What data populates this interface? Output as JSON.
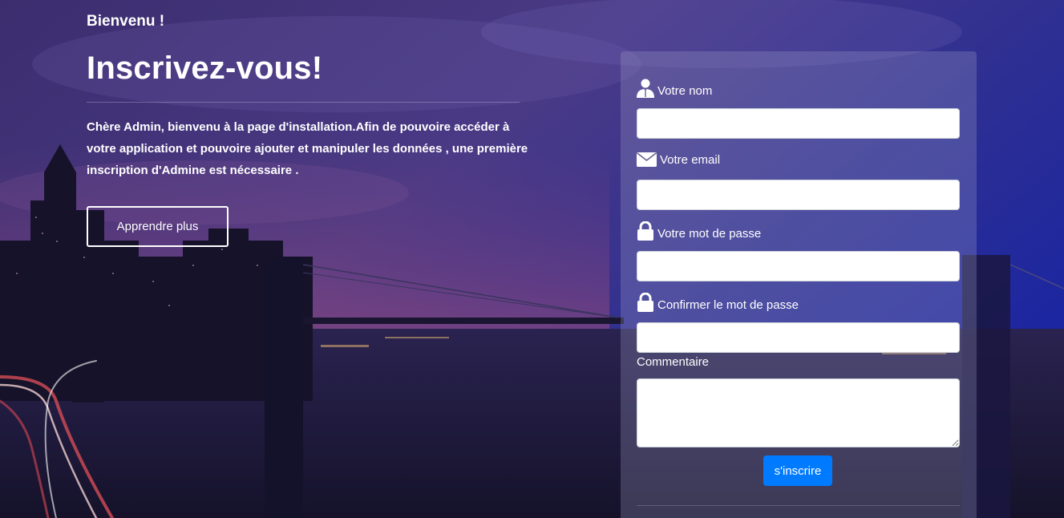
{
  "page": {
    "welcome": "Bienvenu !",
    "headline": "Inscrivez-vous!",
    "intro": "Chère Admin, bienvenu à la page d'installation.Afin de pouvoire accéder à votre application et pouvoire ajouter et manipuler les données , une première inscription d'Admine est nécessaire .",
    "learn_more_label": "Apprendre plus"
  },
  "form": {
    "name_label": "Votre nom",
    "name_icon": "user-icon",
    "email_label": "Votre email",
    "email_icon": "envelope-icon",
    "password_label": "Votre mot de passe",
    "password_icon": "lock-icon",
    "confirm_label": "Confirmer le mot de passe",
    "confirm_icon": "lock-icon",
    "comment_label": "Commentaire",
    "submit_label": "s'inscrire"
  },
  "colors": {
    "accent": "#007bff",
    "panel": "#a0a0c8",
    "text": "#ffffff"
  }
}
